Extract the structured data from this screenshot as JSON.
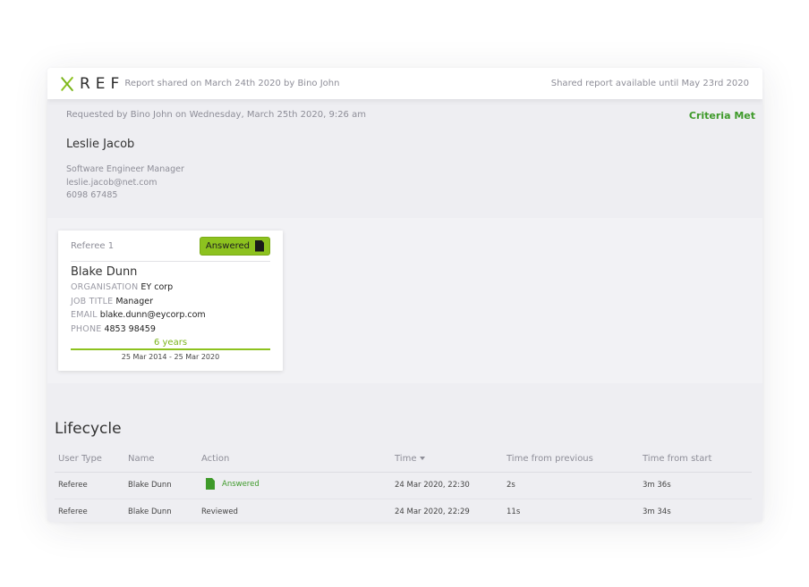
{
  "topbar": {
    "logo_text": "REF",
    "shared": "Report shared on March 24th 2020 by Bino John",
    "available": "Shared report available until May 23rd 2020"
  },
  "candidate": {
    "requested": "Requested by Bino John on Wednesday, March 25th 2020, 9:26 am",
    "status": "Criteria Met",
    "name": "Leslie Jacob",
    "job_title": "Software Engineer Manager",
    "email": "leslie.jacob@net.com",
    "phone": "6098 67485"
  },
  "referee": {
    "label": "Referee 1",
    "status_label": "Answered",
    "name": "Blake Dunn",
    "fields": [
      {
        "key": "ORGANISATION",
        "value": "EY corp"
      },
      {
        "key": "JOB TITLE",
        "value": "Manager"
      },
      {
        "key": "EMAIL",
        "value": "blake.dunn@eycorp.com"
      },
      {
        "key": "PHONE",
        "value": "4853 98459"
      }
    ],
    "duration": "6 years",
    "range": "25 Mar 2014 - 25 Mar 2020"
  },
  "lifecycle": {
    "title": "Lifecycle",
    "columns": [
      "User Type",
      "Name",
      "Action",
      "Time",
      "Time from previous",
      "Time from start"
    ],
    "rows": [
      {
        "user_type": "Referee",
        "name": "Blake Dunn",
        "action": "Answered",
        "time": "24 Mar 2020, 22:30",
        "from_prev": "2s",
        "from_start": "3m 36s"
      },
      {
        "user_type": "Referee",
        "name": "Blake Dunn",
        "action": "Reviewed",
        "time": "24 Mar 2020, 22:29",
        "from_prev": "11s",
        "from_start": "3m 34s"
      }
    ]
  },
  "colors": {
    "brand_green": "#8dc21f",
    "success_green": "#3e9a2a"
  }
}
